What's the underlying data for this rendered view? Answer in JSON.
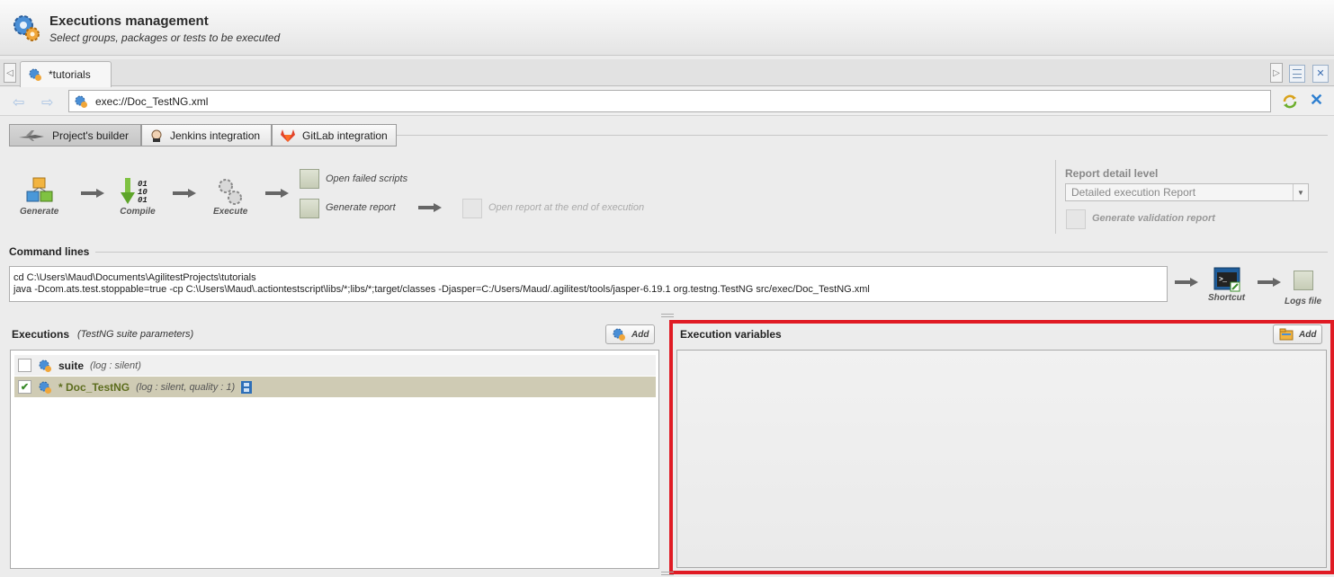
{
  "header": {
    "title": "Executions management",
    "subtitle": "Select groups, packages or tests to be executed"
  },
  "tab": {
    "label": "*tutorials"
  },
  "address": {
    "value": "exec://Doc_TestNG.xml"
  },
  "subtabs": [
    {
      "label": "Project's builder"
    },
    {
      "label": "Jenkins integration"
    },
    {
      "label": "GitLab integration"
    }
  ],
  "pipeline": {
    "generate": "Generate",
    "compile": "Compile",
    "execute": "Execute",
    "open_failed": "Open failed scripts",
    "generate_report": "Generate report",
    "open_report_end": "Open  report at the end of execution"
  },
  "report": {
    "title": "Report detail level",
    "selected": "Detailed execution Report",
    "validation": "Generate validation report"
  },
  "command": {
    "title": "Command lines",
    "line1": "cd C:\\Users\\Maud\\Documents\\AgilitestProjects\\tutorials",
    "line2": "java -Dcom.ats.test.stoppable=true -cp C:\\Users\\Maud\\.actiontestscript\\libs/*;libs/*;target/classes -Djasper=C:/Users/Maud/.agilitest/tools/jasper-6.19.1 org.testng.TestNG src/exec/Doc_TestNG.xml",
    "shortcut": "Shortcut",
    "logs": "Logs file"
  },
  "executions": {
    "title": "Executions",
    "subtitle": "(TestNG suite parameters)",
    "add": "Add",
    "rows": [
      {
        "name": "suite",
        "meta": "(log : silent)",
        "checked": false
      },
      {
        "name": "* Doc_TestNG",
        "meta": "(log : silent, quality : 1)",
        "checked": true
      }
    ]
  },
  "variables": {
    "title": "Execution variables",
    "add": "Add"
  }
}
